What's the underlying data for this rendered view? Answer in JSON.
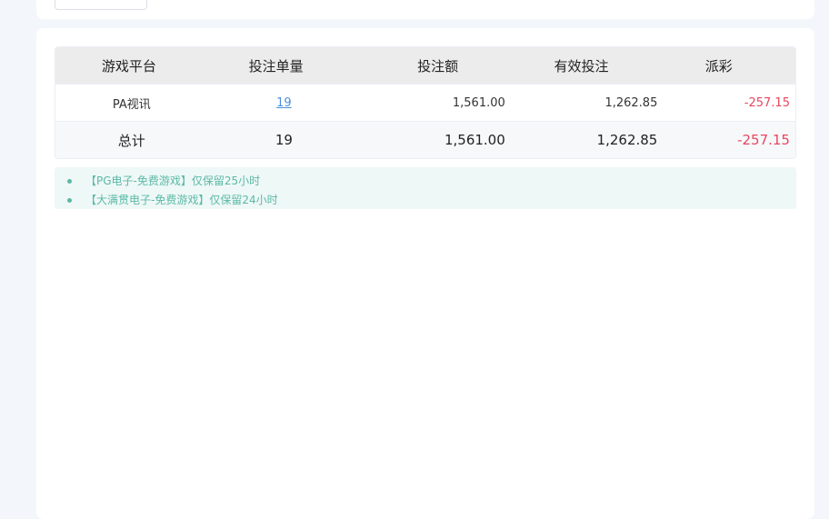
{
  "table": {
    "headers": [
      "游戏平台",
      "投注单量",
      "投注额",
      "有效投注",
      "派彩"
    ],
    "rows": [
      {
        "platform": "PA视讯",
        "bets": "19",
        "amount": "1,561.00",
        "valid": "1,262.85",
        "payout": "-257.15"
      }
    ],
    "total": {
      "label": "总计",
      "bets": "19",
      "amount": "1,561.00",
      "valid": "1,262.85",
      "payout": "-257.15"
    }
  },
  "notices": [
    "【PG电子-免费游戏】仅保留25小时",
    "【大满贯电子-免费游戏】仅保留24小时"
  ],
  "colors": {
    "negative": "#e8475f",
    "link": "#4a90d9",
    "notice_text": "#5cb8a8",
    "notice_bg": "#eef8f6"
  }
}
